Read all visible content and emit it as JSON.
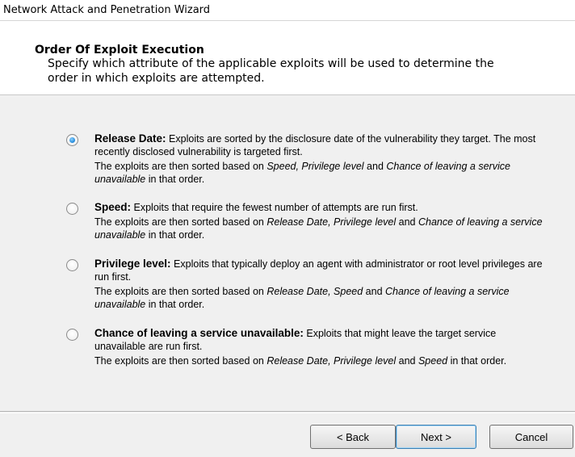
{
  "window": {
    "title": "Network Attack and Penetration Wizard"
  },
  "header": {
    "title": "Order Of Exploit Execution",
    "description": "Specify which attribute of the applicable exploits will be used to determine the order in which exploits are attempted."
  },
  "options": [
    {
      "label": "Release Date:",
      "checked": true,
      "desc": "Exploits are sorted by the disclosure date of the vulnerability they target. The most recently disclosed vulnerability is targeted first.",
      "then_prefix": "The exploits are then sorted based on ",
      "then_italic": "Speed, Privilege level",
      "then_mid": " and ",
      "then_italic2": "Chance of leaving a service unavailable",
      "then_suffix": " in that order."
    },
    {
      "label": "Speed:",
      "checked": false,
      "desc": "Exploits that require the fewest number of attempts are run first.",
      "then_prefix": "The exploits are then sorted based on ",
      "then_italic": "Release Date, Privilege level",
      "then_mid": " and ",
      "then_italic2": "Chance of leaving a service unavailable",
      "then_suffix": " in that order."
    },
    {
      "label": "Privilege level:",
      "checked": false,
      "desc": "Exploits that typically deploy an agent with administrator or root level privileges are run first.",
      "then_prefix": "The exploits are then sorted based on ",
      "then_italic": "Release Date, Speed",
      "then_mid": " and ",
      "then_italic2": "Chance of leaving a service unavailable",
      "then_suffix": " in that order."
    },
    {
      "label": "Chance of leaving a service unavailable:",
      "checked": false,
      "desc": "Exploits that might leave the target service unavailable are run first.",
      "then_prefix": "The exploits are then sorted based on ",
      "then_italic": "Release Date, Privilege level",
      "then_mid": " and ",
      "then_italic2": "Speed",
      "then_suffix": " in that order."
    }
  ],
  "buttons": {
    "back": "< Back",
    "next": "Next >",
    "cancel": "Cancel"
  }
}
